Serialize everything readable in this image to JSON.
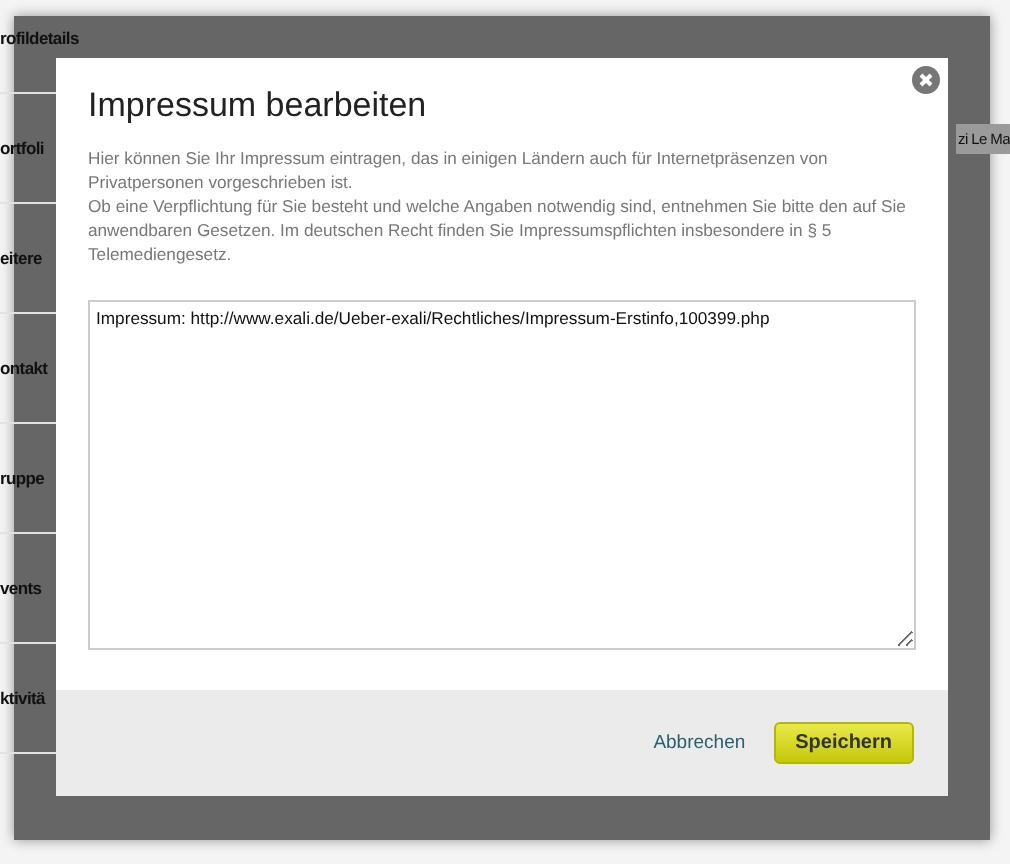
{
  "sidebar": {
    "items": [
      {
        "label": "rofildetails"
      },
      {
        "label": "ortfoli"
      },
      {
        "label": "eitere"
      },
      {
        "label": "ontakt"
      },
      {
        "label": "ruppe"
      },
      {
        "label": "vents"
      },
      {
        "label": "ktivitä"
      }
    ]
  },
  "background_tag": "zi Le Ma",
  "dialog": {
    "title": "Impressum bearbeiten",
    "intro": [
      "Hier können Sie Ihr Impressum eintragen, das in einigen Ländern auch für Internetpräsenzen von Privatpersonen vorgeschrieben ist.",
      "Ob eine Verpflichtung für Sie besteht und welche Angaben notwendig sind, entnehmen Sie bitte den auf Sie anwendbaren Gesetzen. Im deutschen Recht finden Sie Impressumspflichten insbesondere in § 5 Telemediengesetz."
    ],
    "textarea": {
      "value": "Impressum: http://www.exali.de/Ueber-exali/Rechtliches/Impressum-Erstinfo,100399.php"
    },
    "buttons": [
      {
        "label": "Abbrechen",
        "kind": "link"
      },
      {
        "label": "Speichern",
        "kind": "primary"
      }
    ]
  }
}
